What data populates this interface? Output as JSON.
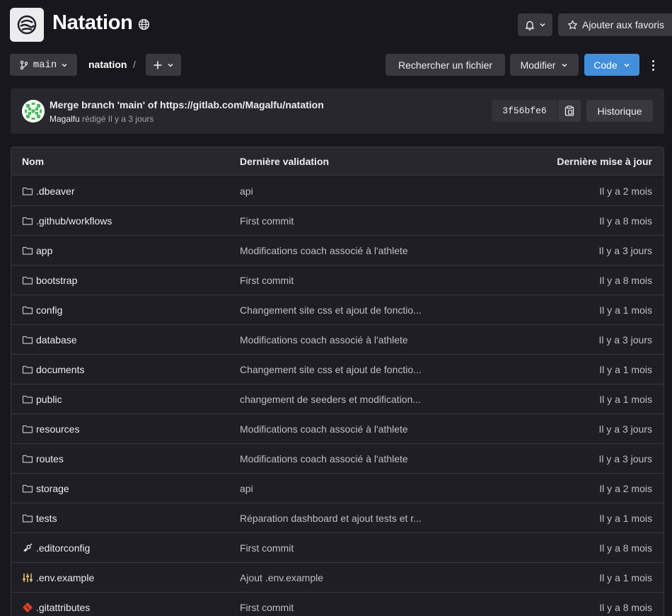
{
  "project": {
    "title": "Natation",
    "visibility_icon": "globe-icon"
  },
  "header": {
    "notifications_icon": "bell-icon",
    "star_label": "Ajouter aux favoris"
  },
  "toolbar": {
    "branch": "main",
    "breadcrumb": "natation",
    "breadcrumb_sep": "/",
    "find_file": "Rechercher un fichier",
    "edit": "Modifier",
    "code": "Code"
  },
  "commit": {
    "title": "Merge branch 'main' of https://gitlab.com/Magalfu/natation",
    "author": "Magalfu",
    "meta": "rédigé Il y a 3 jours",
    "sha": "3f56bfe6",
    "history": "Historique"
  },
  "table": {
    "headers": {
      "name": "Nom",
      "last_commit": "Dernière validation",
      "last_update": "Dernière mise à jour"
    },
    "rows": [
      {
        "name": ".dbeaver",
        "type": "folder",
        "msg": "api",
        "date": "Il y a 2 mois"
      },
      {
        "name": ".github/workflows",
        "type": "folder",
        "msg": "First commit",
        "date": "Il y a 8 mois"
      },
      {
        "name": "app",
        "type": "folder",
        "msg": "Modifications coach associé à l'athlete",
        "date": "Il y a 3 jours"
      },
      {
        "name": "bootstrap",
        "type": "folder",
        "msg": "First commit",
        "date": "Il y a 8 mois"
      },
      {
        "name": "config",
        "type": "folder",
        "msg": "Changement site css et ajout de fonctio...",
        "date": "Il y a 1 mois"
      },
      {
        "name": "database",
        "type": "folder",
        "msg": "Modifications coach associé à l'athlete",
        "date": "Il y a 3 jours"
      },
      {
        "name": "documents",
        "type": "folder",
        "msg": "Changement site css et ajout de fonctio...",
        "date": "Il y a 1 mois"
      },
      {
        "name": "public",
        "type": "folder",
        "msg": "changement de seeders et modification...",
        "date": "Il y a 1 mois"
      },
      {
        "name": "resources",
        "type": "folder",
        "msg": "Modifications coach associé à l'athlete",
        "date": "Il y a 3 jours"
      },
      {
        "name": "routes",
        "type": "folder",
        "msg": "Modifications coach associé à l'athlete",
        "date": "Il y a 3 jours"
      },
      {
        "name": "storage",
        "type": "folder",
        "msg": "api",
        "date": "Il y a 2 mois"
      },
      {
        "name": "tests",
        "type": "folder",
        "msg": "Réparation dashboard et ajout tests et r...",
        "date": "Il y a 1 mois"
      },
      {
        "name": ".editorconfig",
        "type": "editorconfig",
        "msg": "First commit",
        "date": "Il y a 8 mois"
      },
      {
        "name": ".env.example",
        "type": "env",
        "msg": "Ajout .env.example",
        "date": "Il y a 1 mois"
      },
      {
        "name": ".gitattributes",
        "type": "git",
        "msg": "First commit",
        "date": "Il y a 8 mois"
      }
    ]
  },
  "colors": {
    "accent": "#428fdc",
    "background": "#18171d",
    "git_orange": "#e24329",
    "env_yellow": "#e9be74"
  }
}
